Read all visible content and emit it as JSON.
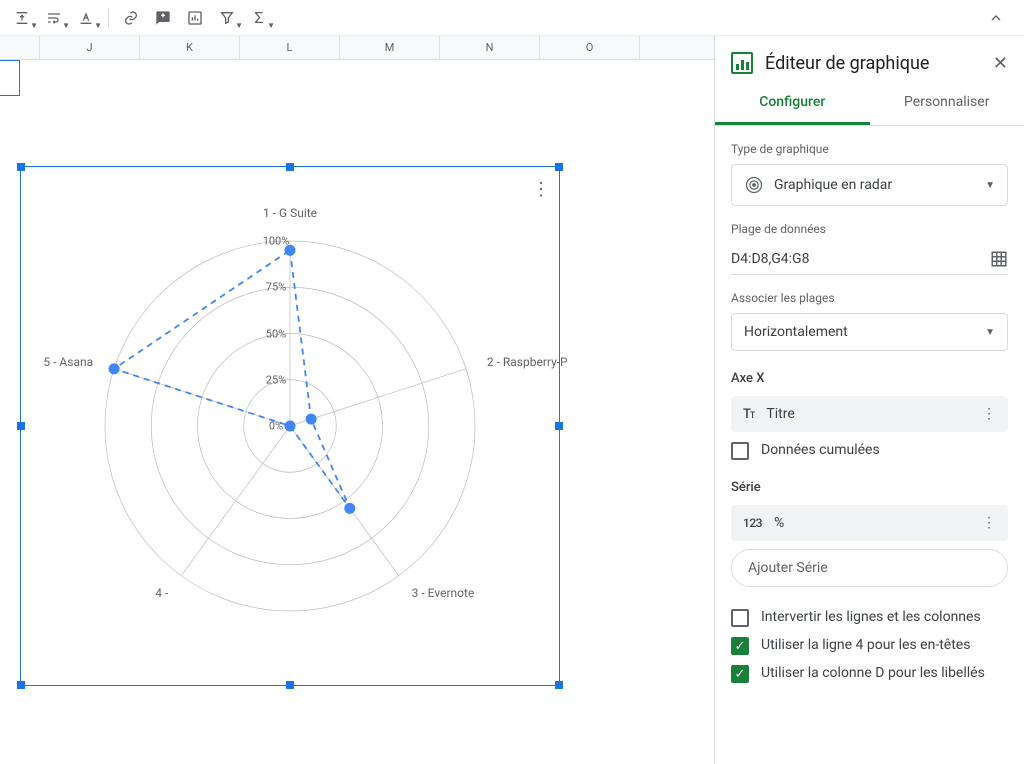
{
  "columns": [
    "",
    "J",
    "K",
    "L",
    "M",
    "N",
    "O"
  ],
  "chart_data": {
    "type": "radar",
    "categories": [
      "1 - G Suite",
      "2 - Raspberry-P",
      "3 - Evernote",
      "4 - ",
      "5 - Asana"
    ],
    "series": [
      {
        "name": "%",
        "values": [
          95,
          12,
          55,
          0,
          100
        ]
      }
    ],
    "ticks": [
      "0%",
      "25%",
      "50%",
      "75%",
      "100%"
    ],
    "max": 100
  },
  "panel": {
    "title": "Éditeur de graphique",
    "tabs": {
      "configure": "Configurer",
      "customize": "Personnaliser"
    },
    "chart_type_label": "Type de graphique",
    "chart_type_value": "Graphique en radar",
    "data_range_label": "Plage de données",
    "data_range_value": "D4:D8,G4:G8",
    "combine_label": "Associer les plages",
    "combine_value": "Horizontalement",
    "xaxis_title": "Axe X",
    "xaxis_chip": "Titre",
    "aggregate_label": "Données cumulées",
    "series_title": "Série",
    "series_chip": "%",
    "add_series": "Ajouter Série",
    "switch_rows": "Intervertir les lignes et les colonnes",
    "use_row_headers": "Utiliser la ligne 4 pour les en-têtes",
    "use_col_labels": "Utiliser la colonne D pour les libellés"
  }
}
